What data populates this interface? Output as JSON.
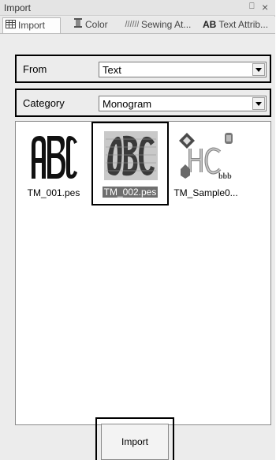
{
  "panel": {
    "title": "Import",
    "pin_glyph": "⎕",
    "close_glyph": "×"
  },
  "tabs": [
    {
      "label": "Import",
      "icon": "import-grid-icon"
    },
    {
      "label": "Color",
      "icon": "spool-icon"
    },
    {
      "label": "Sewing At...",
      "icon": "stitch-icon"
    },
    {
      "label": "Text Attrib...",
      "icon": "text-ab-icon",
      "icon_text": "AB"
    }
  ],
  "from": {
    "label": "From",
    "value": "Text"
  },
  "category": {
    "label": "Category",
    "value": "Monogram"
  },
  "gallery": {
    "items": [
      {
        "name": "TM_001.pes",
        "thumb": "ABC"
      },
      {
        "name": "TM_002.pes",
        "thumb": "ABC",
        "selected": true
      },
      {
        "name": "TM_Sample0...",
        "thumb": "HC"
      }
    ]
  },
  "import_button": {
    "label": "Import"
  },
  "colors": {
    "accent": "#000000",
    "selection": "#6f6f6f",
    "background": "#ececec"
  }
}
